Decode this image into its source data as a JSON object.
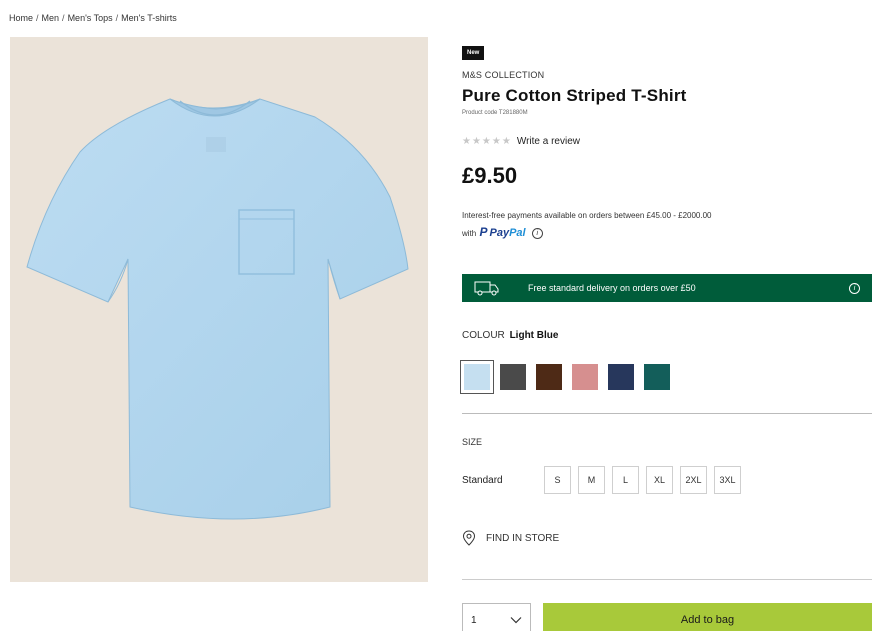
{
  "breadcrumb": {
    "items": [
      "Home",
      "Men",
      "Men's Tops",
      "Men's T-shirts"
    ],
    "separator": "/"
  },
  "product_image": {
    "background_color": "#ebe3d9",
    "shirt_color": "#b3d7ef"
  },
  "product": {
    "badge": "New",
    "brand": "M&S COLLECTION",
    "title": "Pure Cotton Striped T-Shirt",
    "code": "Product code T281880M",
    "rating_stars": 0,
    "rating_max": 5,
    "review_link": "Write a review",
    "price": "£9.50"
  },
  "paypal": {
    "line1": "Interest-free payments available on orders between £45.00 - £2000.00",
    "with": "with",
    "logo_pay": "Pay",
    "logo_pal": "Pal"
  },
  "delivery": {
    "text": "Free standard delivery on orders over £50",
    "background": "#005c3a"
  },
  "colour": {
    "label": "COLOUR",
    "selected": "Light Blue",
    "swatches": [
      "#c5dff0",
      "#4a4a4a",
      "#4e2a16",
      "#d68f8f",
      "#27375c",
      "#135e5a"
    ]
  },
  "size": {
    "label": "SIZE",
    "fit": "Standard",
    "options": [
      "S",
      "M",
      "L",
      "XL",
      "2XL",
      "3XL"
    ]
  },
  "store": {
    "find_label": "FIND IN STORE"
  },
  "purchase": {
    "quantity": "1",
    "add_label": "Add to bag",
    "button_color": "#a8c93a"
  }
}
